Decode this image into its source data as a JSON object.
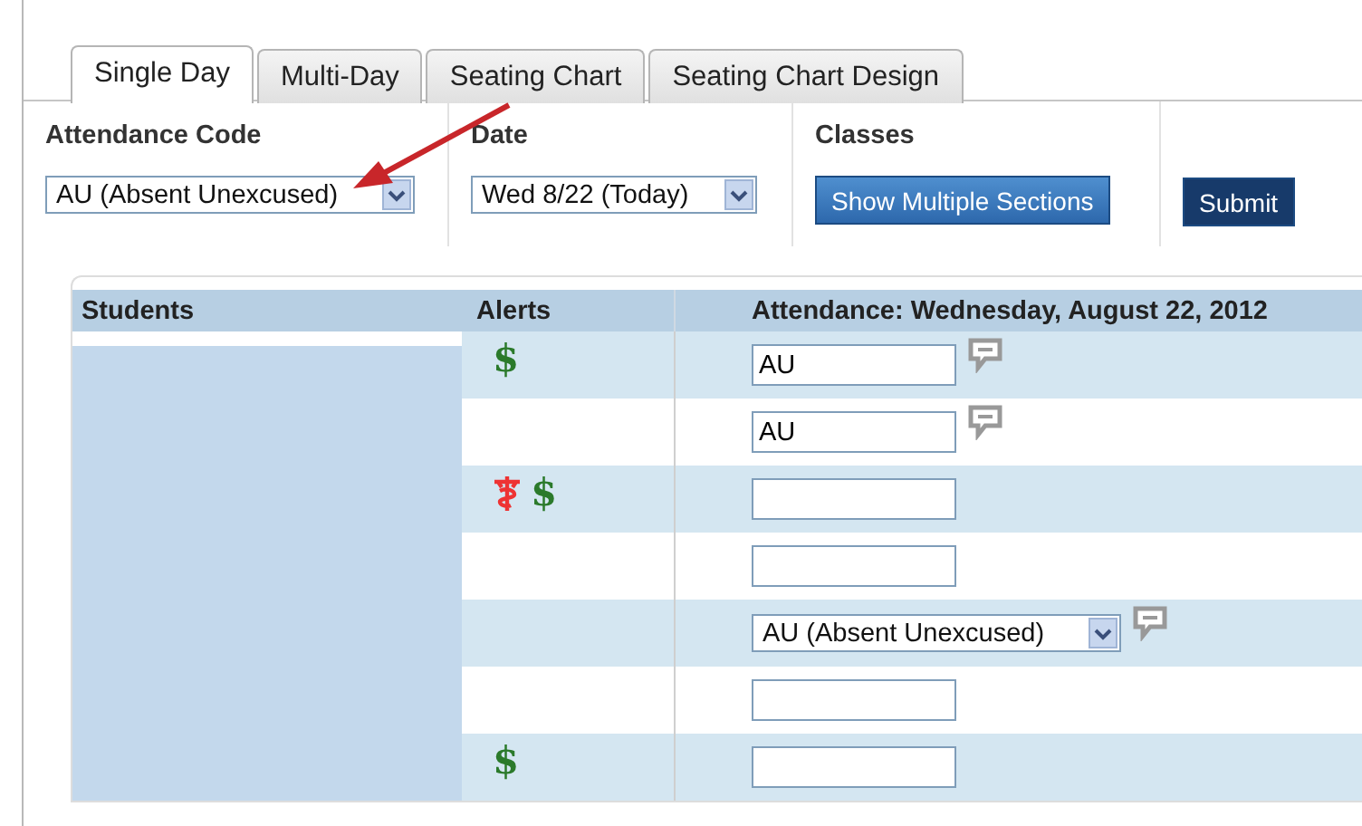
{
  "tabs": [
    {
      "label": "Single Day",
      "selected": true
    },
    {
      "label": "Multi-Day",
      "selected": false
    },
    {
      "label": "Seating Chart",
      "selected": false
    },
    {
      "label": "Seating Chart Design",
      "selected": false
    }
  ],
  "controls": {
    "attendance_code": {
      "label": "Attendance Code",
      "value": "AU (Absent Unexcused)"
    },
    "date": {
      "label": "Date",
      "value": "Wed 8/22 (Today)"
    },
    "classes": {
      "label": "Classes",
      "button": "Show Multiple Sections"
    },
    "submit": "Submit"
  },
  "table": {
    "columns": [
      "Students",
      "Alerts",
      "Attendance: Wednesday, August 22, 2012"
    ],
    "rows": [
      {
        "alerts": [
          {
            "kind": "text",
            "text": "$"
          }
        ],
        "entry": {
          "kind": "field",
          "value": "AU"
        },
        "comment": true
      },
      {
        "alerts": [],
        "entry": {
          "kind": "field",
          "value": "AU"
        },
        "comment": true
      },
      {
        "alerts": [
          {
            "kind": "medical"
          },
          {
            "kind": "text",
            "text": "$"
          }
        ],
        "entry": {
          "kind": "field"
        },
        "comment": false
      },
      {
        "alerts": [],
        "entry": {
          "kind": "field"
        },
        "comment": false
      },
      {
        "alerts": [],
        "entry": {
          "kind": "select",
          "value": "AU (Absent Unexcused)"
        },
        "comment": true
      },
      {
        "alerts": [],
        "entry": {
          "kind": "field"
        },
        "comment": false
      },
      {
        "alerts": [
          {
            "kind": "text",
            "text": "$"
          }
        ],
        "entry": {
          "kind": "field"
        },
        "comment": false
      }
    ]
  }
}
